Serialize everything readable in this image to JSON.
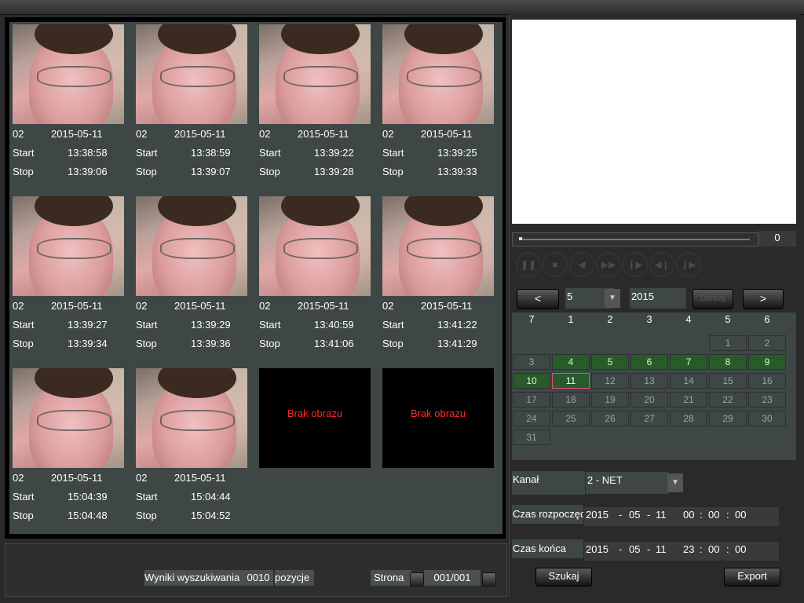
{
  "results": [
    {
      "ch": "02",
      "date": "2015-05-11",
      "start_label": "Start",
      "start": "13:38:58",
      "stop_label": "Stop",
      "stop": "13:39:06"
    },
    {
      "ch": "02",
      "date": "2015-05-11",
      "start_label": "Start",
      "start": "13:38:59",
      "stop_label": "Stop",
      "stop": "13:39:07"
    },
    {
      "ch": "02",
      "date": "2015-05-11",
      "start_label": "Start",
      "start": "13:39:22",
      "stop_label": "Stop",
      "stop": "13:39:28"
    },
    {
      "ch": "02",
      "date": "2015-05-11",
      "start_label": "Start",
      "start": "13:39:25",
      "stop_label": "Stop",
      "stop": "13:39:33"
    },
    {
      "ch": "02",
      "date": "2015-05-11",
      "start_label": "Start",
      "start": "13:39:27",
      "stop_label": "Stop",
      "stop": "13:39:34"
    },
    {
      "ch": "02",
      "date": "2015-05-11",
      "start_label": "Start",
      "start": "13:39:29",
      "stop_label": "Stop",
      "stop": "13:39:36"
    },
    {
      "ch": "02",
      "date": "2015-05-11",
      "start_label": "Start",
      "start": "13:40:59",
      "stop_label": "Stop",
      "stop": "13:41:06"
    },
    {
      "ch": "02",
      "date": "2015-05-11",
      "start_label": "Start",
      "start": "13:41:22",
      "stop_label": "Stop",
      "stop": "13:41:29"
    },
    {
      "ch": "02",
      "date": "2015-05-11",
      "start_label": "Start",
      "start": "15:04:39",
      "stop_label": "Stop",
      "stop": "15:04:48"
    },
    {
      "ch": "02",
      "date": "2015-05-11",
      "start_label": "Start",
      "start": "15:04:44",
      "stop_label": "Stop",
      "stop": "15:04:52"
    }
  ],
  "no_image_text": "Brak obrazu",
  "footer": {
    "results_label": "Wyniki wyszukiwania",
    "results_count": "0010",
    "results_unit": "pozycje",
    "page_label": "Strona",
    "page_value": "001/001"
  },
  "player": {
    "position_value": "0",
    "controls": [
      "pause-icon",
      "stop-icon",
      "reverse-play-icon",
      "fast-forward-icon",
      "step-forward-icon",
      "step-back-icon",
      "play-icon"
    ]
  },
  "calendar": {
    "prev_label": "<",
    "next_label": ">",
    "month": "5",
    "year": "2015",
    "today_label": "Dzisiaj",
    "dow": [
      "7",
      "1",
      "2",
      "3",
      "4",
      "5",
      "6"
    ],
    "days": [
      "1",
      "2",
      "3",
      "4",
      "5",
      "6",
      "7",
      "8",
      "9",
      "10",
      "11",
      "12",
      "13",
      "14",
      "15",
      "16",
      "17",
      "18",
      "19",
      "20",
      "21",
      "22",
      "23",
      "24",
      "25",
      "26",
      "27",
      "28",
      "29",
      "30",
      "31"
    ],
    "first_day_col": 5,
    "record_days": [
      4,
      5,
      6,
      7,
      8,
      9,
      10,
      11
    ],
    "selected_day": 11,
    "colors": {
      "record": "#295a2a",
      "selected_border": "#e0507a"
    }
  },
  "search": {
    "channel_label": "Kanał",
    "channel_value": "2 - NET",
    "start_label": "Czas rozpoczęcia",
    "start_y": "2015",
    "start_m": "05",
    "start_d": "11",
    "start_h": "00",
    "start_mi": "00",
    "start_s": "00",
    "end_label": "Czas końca",
    "end_y": "2015",
    "end_m": "05",
    "end_d": "11",
    "end_h": "23",
    "end_mi": "00",
    "end_s": "00",
    "sep_date": "-",
    "sep_time": ":",
    "search_button": "Szukaj",
    "export_button": "Export"
  }
}
